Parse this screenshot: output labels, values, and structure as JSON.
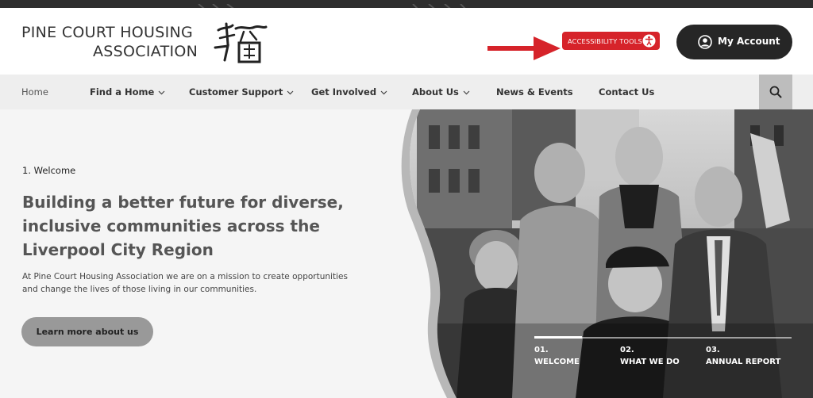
{
  "header": {
    "logo_line1": "PINE COURT HOUSING",
    "logo_line2": "ASSOCIATION",
    "accessibility_label": "ACCESSIBILITY TOOLS",
    "account_label": "My Account"
  },
  "nav": {
    "items": [
      {
        "label": "Home",
        "dropdown": false
      },
      {
        "label": "Find a Home",
        "dropdown": true
      },
      {
        "label": "Customer Support",
        "dropdown": true
      },
      {
        "label": "Get Involved",
        "dropdown": true
      },
      {
        "label": "About Us",
        "dropdown": true
      },
      {
        "label": "News & Events",
        "dropdown": false
      },
      {
        "label": "Contact Us",
        "dropdown": false
      }
    ],
    "search_icon": "search-icon"
  },
  "hero": {
    "eyebrow": "1. Welcome",
    "title": "Building a better future for diverse, inclusive communities across the Liverpool City Region",
    "description": "At Pine Court Housing Association we are on a mission to create opportunities and change the lives of those living in our communities.",
    "cta_label": "Learn more about us",
    "slides": [
      {
        "number": "01.",
        "label": "WELCOME"
      },
      {
        "number": "02.",
        "label": "WHAT WE DO"
      },
      {
        "number": "03.",
        "label": "ANNUAL REPORT"
      }
    ]
  },
  "colors": {
    "accent_red": "#d6232a",
    "account_button": "#262626",
    "nav_bg": "#eeeeee",
    "cta_bg": "#999999"
  }
}
